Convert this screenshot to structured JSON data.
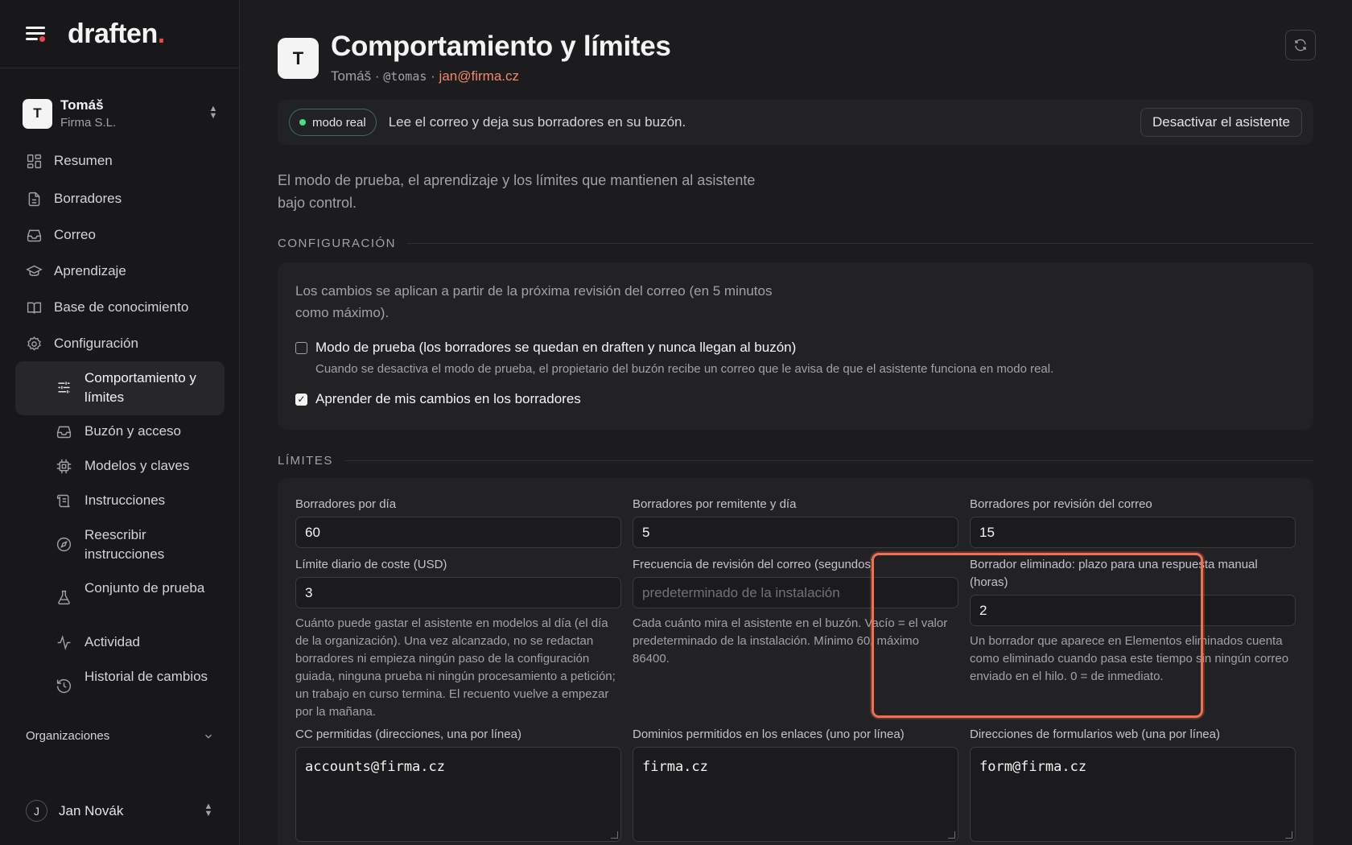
{
  "app": {
    "name": "draften"
  },
  "account": {
    "name": "Tomáš",
    "org": "Firma S.L.",
    "initial": "T"
  },
  "nav": {
    "items": [
      {
        "label": "Resumen",
        "icon": "dashboard-icon"
      },
      {
        "label": "Borradores",
        "icon": "document-icon"
      },
      {
        "label": "Correo",
        "icon": "inbox-icon"
      },
      {
        "label": "Aprendizaje",
        "icon": "graduation-cap-icon"
      },
      {
        "label": "Base de conocimiento",
        "icon": "book-icon"
      },
      {
        "label": "Configuración",
        "icon": "gear-icon"
      }
    ],
    "sub_items": [
      {
        "label": "Comportamiento y límites",
        "icon": "sliders-icon",
        "active": true
      },
      {
        "label": "Buzón y acceso",
        "icon": "inbox-icon"
      },
      {
        "label": "Modelos y claves",
        "icon": "chip-icon"
      },
      {
        "label": "Instrucciones",
        "icon": "scroll-icon"
      },
      {
        "label": "Reescribir instrucciones",
        "icon": "compass-icon"
      },
      {
        "label": "Conjunto de prueba",
        "icon": "flask-icon"
      },
      {
        "label": "Actividad",
        "icon": "activity-icon"
      },
      {
        "label": "Historial de cambios",
        "icon": "history-icon"
      }
    ],
    "orgs_label": "Organizaciones"
  },
  "user": {
    "name": "Jan Novák",
    "initial": "J"
  },
  "header": {
    "initial": "T",
    "title": "Comportamiento y límites",
    "user_name": "Tomáš",
    "handle": "@tomas",
    "email": "jan@firma.cz",
    "separator": "·"
  },
  "mode": {
    "badge": "modo real",
    "description": "Lee el correo y deja sus borradores en su buzón.",
    "deactivate_label": "Desactivar el asistente"
  },
  "intro": "El modo de prueba, el aprendizaje y los límites que mantienen al asistente bajo control.",
  "config": {
    "section_title": "CONFIGURACIÓN",
    "note": "Los cambios se aplican a partir de la próxima revisión del correo (en 5 minutos como máximo).",
    "test_mode": {
      "label": "Modo de prueba (los borradores se quedan en draften y nunca llegan al buzón)",
      "help": "Cuando se desactiva el modo de prueba, el propietario del buzón recibe un correo que le avisa de que el asistente funciona en modo real.",
      "checked": false
    },
    "learn": {
      "label": "Aprender de mis cambios en los borradores",
      "checked": true
    }
  },
  "limits": {
    "section_title": "LÍMITES",
    "drafts_per_day": {
      "label": "Borradores por día",
      "value": "60"
    },
    "drafts_per_sender": {
      "label": "Borradores por remitente y día",
      "value": "5"
    },
    "drafts_per_check": {
      "label": "Borradores por revisión del correo",
      "value": "15"
    },
    "daily_cost": {
      "label": "Límite diario de coste (USD)",
      "value": "3",
      "help": "Cuánto puede gastar el asistente en modelos al día (el día de la organización). Una vez alcanzado, no se redactan borradores ni empieza ningún paso de la configuración guiada, ninguna prueba ni ningún procesamiento a petición; un trabajo en curso termina. El recuento vuelve a empezar por la mañana."
    },
    "check_frequency": {
      "label": "Frecuencia de revisión del correo (segundos)",
      "value": "",
      "placeholder": "predeterminado de la instalación",
      "help": "Cada cuánto mira el asistente en el buzón. Vacío = el valor predeterminado de la instalación. Mínimo 60, máximo 86400."
    },
    "deleted_draft": {
      "label": "Borrador eliminado: plazo para una respuesta manual (horas)",
      "value": "2",
      "help": "Un borrador que aparece en Elementos eliminados cuenta como eliminado cuando pasa este tiempo sin ningún correo enviado en el hilo. 0 = de inmediato."
    },
    "cc_allowed": {
      "label": "CC permitidas (direcciones, una por línea)",
      "value": "accounts@firma.cz"
    },
    "link_domains": {
      "label": "Dominios permitidos en los enlaces (uno por línea)",
      "value": "firma.cz"
    },
    "form_addresses": {
      "label": "Direcciones de formularios web (una por línea)",
      "value": "form@firma.cz"
    }
  },
  "colors": {
    "accent": "#f2704f",
    "live": "#4ade80",
    "brand_dot": "#ef4444"
  }
}
